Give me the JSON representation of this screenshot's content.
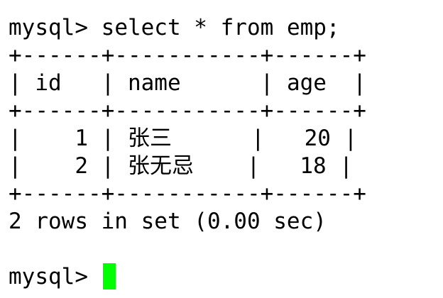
{
  "terminal": {
    "prompt": "mysql> ",
    "command": "select * from emp;",
    "border": "+------+-----------+------+",
    "header": {
      "id": "id",
      "name": "name",
      "age": "age"
    },
    "rows": [
      {
        "id": "1",
        "name": "张三",
        "age": "20"
      },
      {
        "id": "2",
        "name": "张无忌",
        "age": "18"
      }
    ],
    "summary": "2 rows in set (0.00 sec)",
    "cursor_color": "#00ff00"
  }
}
